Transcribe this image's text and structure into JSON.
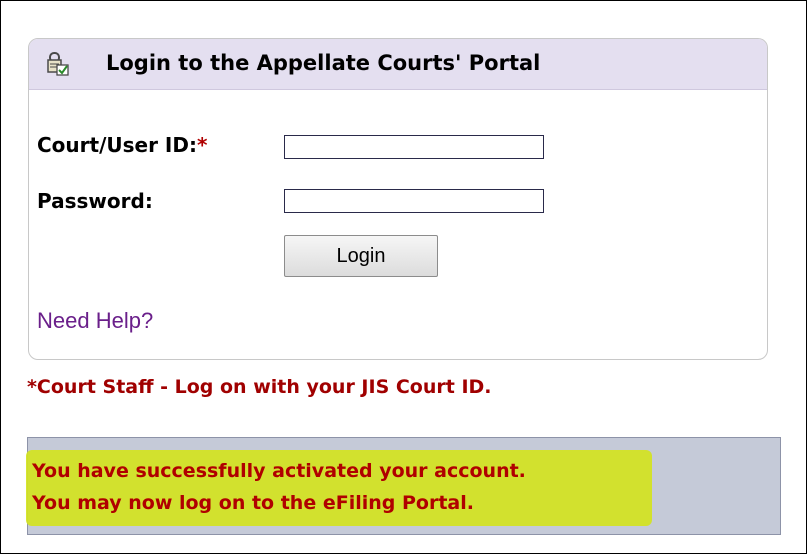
{
  "login_panel": {
    "title": "Login to the Appellate Courts' Portal",
    "icon": "lock-icon",
    "header_color": "#e4dff0",
    "fields": {
      "user_id": {
        "label": "Court/User ID:",
        "required_marker": "*",
        "value": ""
      },
      "password": {
        "label": "Password:",
        "value": ""
      }
    },
    "login_button_label": "Login",
    "help_link_label": "Need Help?",
    "help_link_color": "#6a1f8a"
  },
  "staff_note": "*Court Staff - Log on with your JIS Court ID.",
  "status_message": {
    "line1": "You have successfully activated your account.",
    "line2": "You may now log on to the eFiling Portal.",
    "text_color": "#b00000",
    "highlight_color": "#d2e31f",
    "box_color": "#c5cad8"
  }
}
